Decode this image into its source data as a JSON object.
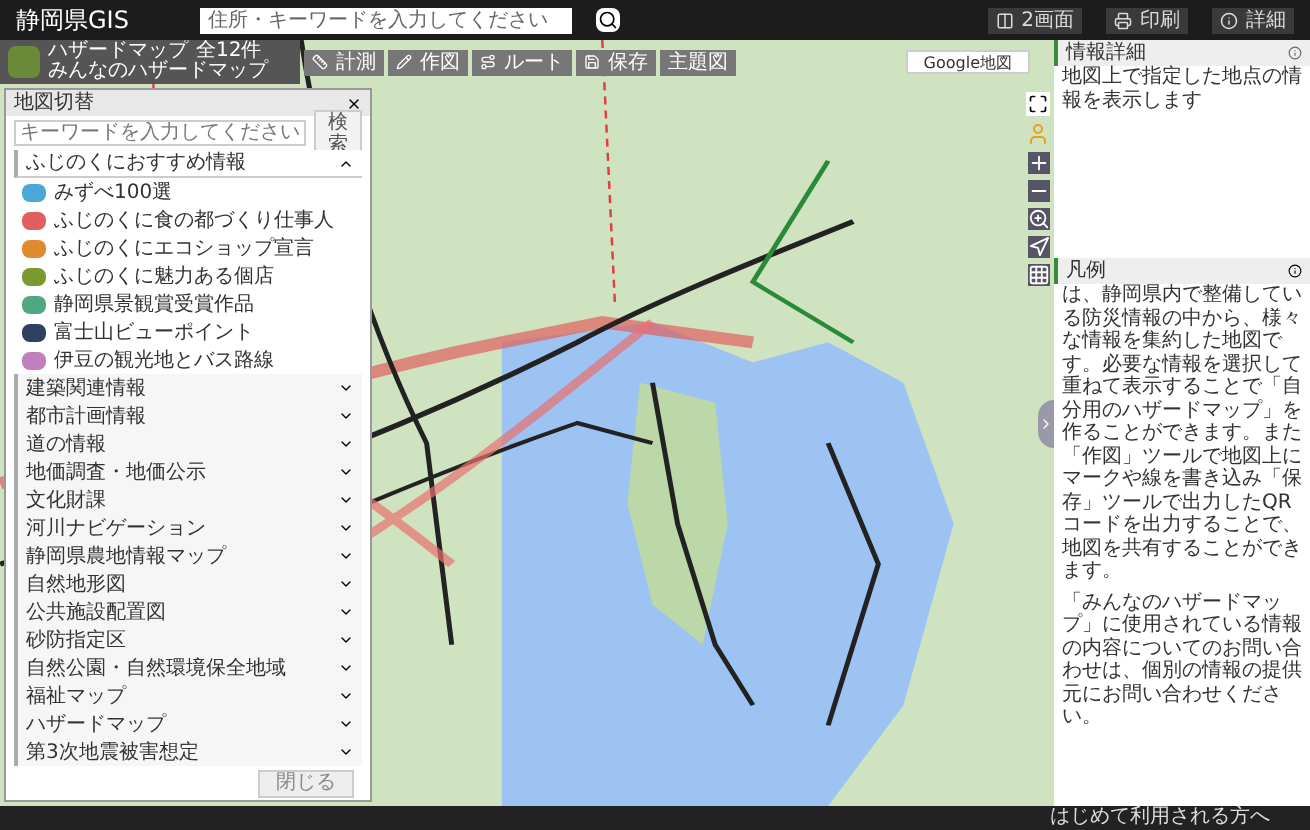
{
  "header": {
    "title": "静岡県GIS",
    "search": {
      "placeholder": "住所・キーワードを入力してください"
    },
    "buttons": [
      {
        "label": "2画面"
      },
      {
        "label": "印刷"
      },
      {
        "label": "詳細"
      }
    ]
  },
  "layer_card": {
    "title": "ハザードマップ",
    "count": "全12件",
    "subtitle": "みんなのハザードマップ"
  },
  "toolbar": [
    {
      "label": "計測"
    },
    {
      "label": "作図"
    },
    {
      "label": "ルート"
    },
    {
      "label": "保存"
    },
    {
      "label": "主題図"
    }
  ],
  "map": {
    "type_button": "Google地図"
  },
  "map_panel": {
    "title": "地図切替",
    "search": {
      "placeholder": "キーワードを入力してください",
      "button": "検索"
    },
    "sections": [
      {
        "label": "ふじのくにおすすめ情報",
        "expanded": true,
        "children": [
          {
            "label": "みずべ100選",
            "color": "#4aa8d8"
          },
          {
            "label": "ふじのくに食の都づくり仕事人",
            "color": "#e06060"
          },
          {
            "label": "ふじのくにエコショップ宣言",
            "color": "#e08a30"
          },
          {
            "label": "ふじのくに魅力ある個店",
            "color": "#7a9a30"
          },
          {
            "label": "静岡県景観賞受賞作品",
            "color": "#50a880"
          },
          {
            "label": "富士山ビューポイント",
            "color": "#304060"
          },
          {
            "label": "伊豆の観光地とバス路線",
            "color": "#c080c0"
          }
        ]
      },
      {
        "label": "建築関連情報",
        "expanded": false
      },
      {
        "label": "都市計画情報",
        "expanded": false
      },
      {
        "label": "道の情報",
        "expanded": false
      },
      {
        "label": "地価調査・地価公示",
        "expanded": false
      },
      {
        "label": "文化財課",
        "expanded": false
      },
      {
        "label": "河川ナビゲーション",
        "expanded": false
      },
      {
        "label": "静岡県農地情報マップ",
        "expanded": false
      },
      {
        "label": "自然地形図",
        "expanded": false
      },
      {
        "label": "公共施設配置図",
        "expanded": false
      },
      {
        "label": "砂防指定区",
        "expanded": false
      },
      {
        "label": "自然公園・自然環境保全地域",
        "expanded": false
      },
      {
        "label": "福祉マップ",
        "expanded": false
      },
      {
        "label": "ハザードマップ",
        "expanded": false
      },
      {
        "label": "第3次地震被害想定",
        "expanded": false
      }
    ],
    "close_button": "閉じる"
  },
  "info_panel": {
    "title": "情報詳細",
    "text": "地図上で指定した地点の情報を表示します"
  },
  "legend_panel": {
    "title": "凡例",
    "paragraphs": [
      "は、静岡県内で整備している防災情報の中から、様々な情報を集約した地図です。必要な情報を選択して重ねて表示することで「自分用のハザードマップ」を作ることができます。また「作図」ツールで地図上にマークや線を書き込み「保存」ツールで出力したQRコードを出力することで、地図を共有することができます。",
      "「みんなのハザードマップ」に使用されている情報の内容についてのお問い合わせは、個別の情報の提供元にお問い合わせください。"
    ]
  },
  "status_bar": {
    "link": "はじめて利用される方へ"
  }
}
